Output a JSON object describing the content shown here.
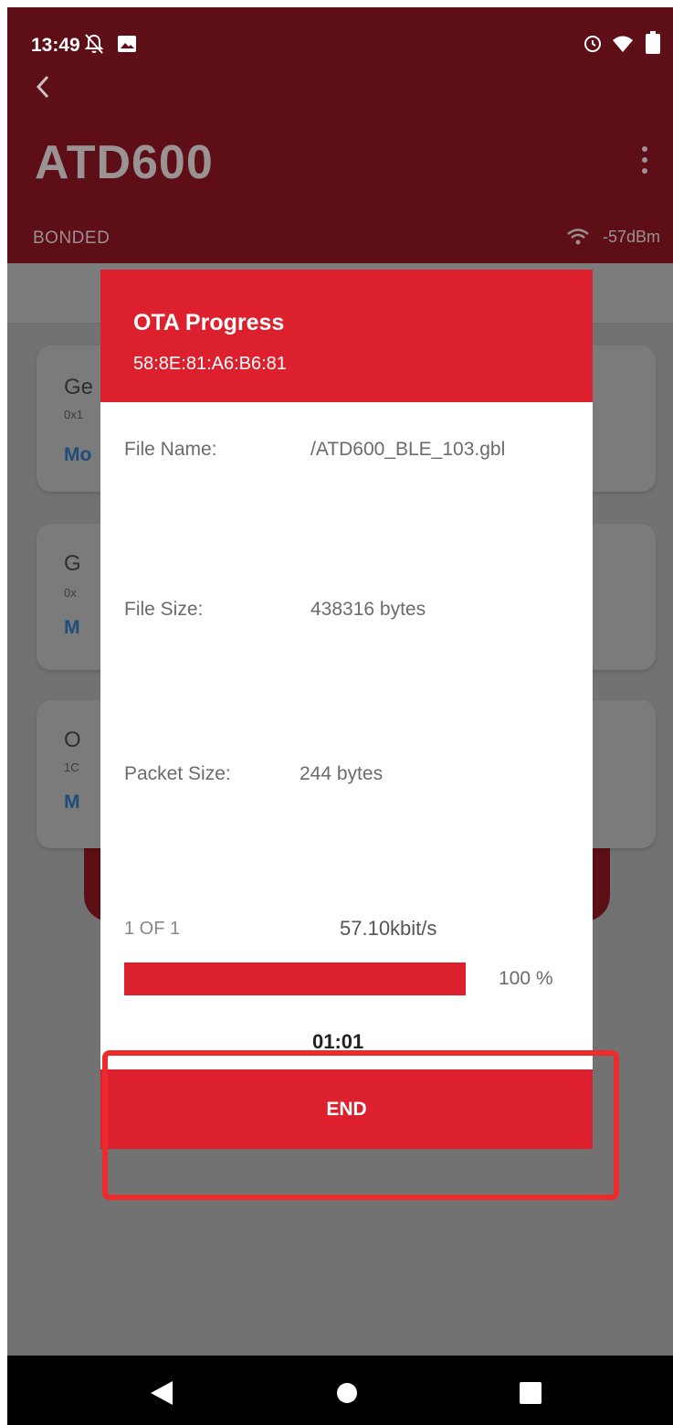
{
  "status_bar": {
    "time": "13:49",
    "icons": [
      "notifications-off-icon",
      "image-icon",
      "alarm-icon",
      "wifi-icon",
      "battery-icon"
    ],
    "battery_level": "97"
  },
  "app_bar": {
    "title": "ATD600",
    "connection_state": "BONDED",
    "rssi": "-57dBm"
  },
  "background_services": [
    {
      "title": "Ge",
      "uuid": "0x1",
      "more": "Mo"
    },
    {
      "title": "G",
      "uuid": "0x",
      "more": "M"
    },
    {
      "title": "O",
      "uuid": "1C",
      "more": "M"
    }
  ],
  "dialog": {
    "title": "OTA Progress",
    "address": "58:8E:81:A6:B6:81",
    "file_name_label": "File Name:",
    "file_name_value": "/ATD600_BLE_103.gbl",
    "file_size_label": "File Size:",
    "file_size_value": "438316 bytes",
    "packet_size_label": "Packet Size:",
    "packet_size_value": "244 bytes",
    "part": "1 OF 1",
    "speed": "57.10kbit/s",
    "progress_fraction": 1.0,
    "progress_percent": "100 %",
    "elapsed": "01:01",
    "end_button": "END"
  },
  "colors": {
    "accent": "#dc202d",
    "app_bar_dimmed": "#5d0e17",
    "highlight": "#ee2b2b"
  }
}
